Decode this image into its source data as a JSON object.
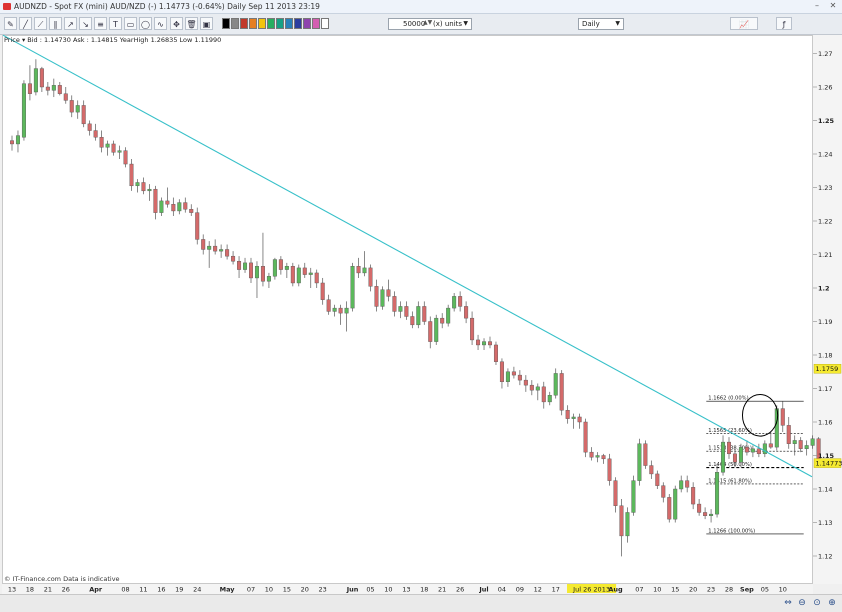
{
  "window": {
    "title": "AUDNZD - Spot FX (mini) AUD/NZD (-)   1.14773 (-0.64%)   Daily  Sep 11 2013 23:19",
    "units_value": "50000",
    "units_label": "(x) units",
    "period": "Daily"
  },
  "chart_header": {
    "price_label": "Price",
    "quote_info": "Bid : 1.14730 Ask : 1.14815 YearHigh 1.26835 Low 1.11990"
  },
  "footer": {
    "credit": "© IT-Finance.com  Data is indicative"
  },
  "icons": {
    "title": "app-icon",
    "minimize": "minimize-icon",
    "close": "close-icon",
    "toolbar": [
      "pencil-icon",
      "line-icon",
      "ray-icon",
      "channel-icon",
      "arrow-icon",
      "fibonacci-icon",
      "text-icon",
      "rectangle-icon",
      "ellipse-icon",
      "trash-icon"
    ],
    "bottom": [
      "zoom-in-icon",
      "zoom-out-icon",
      "fit-icon",
      "search-icon"
    ]
  },
  "colors": {
    "up_candle": "#5cb85c",
    "down_candle": "#d46a6a",
    "trendline": "#37c0c9",
    "price_label_current": "#f5ea30",
    "price_label_alt": "#f5ea30",
    "axis_highlight": "#f5ea30"
  },
  "chart_data": {
    "type": "candlestick",
    "instrument": "AUDNZD",
    "ylim": [
      1.114,
      1.275
    ],
    "y_ticks": [
      "1.27",
      "1.26",
      "1.25",
      "1.24",
      "1.23",
      "1.22",
      "1.21",
      "1.2",
      "1.19",
      "1.18",
      "1.17",
      "1.16",
      "1.15",
      "1.14",
      "1.13",
      "1.12"
    ],
    "y_ticks_bold": [
      "1.25",
      "1.2",
      "1.15"
    ],
    "current_price": {
      "label": "1.14773",
      "value": 1.14773
    },
    "marker_price": {
      "label": "1.1759",
      "value": 1.1759
    },
    "x_ticks": [
      {
        "label": "13",
        "i": 0
      },
      {
        "label": "18",
        "i": 3
      },
      {
        "label": "21",
        "i": 6
      },
      {
        "label": "26",
        "i": 9
      },
      {
        "label": "Apr",
        "i": 14,
        "bold": true
      },
      {
        "label": "08",
        "i": 19
      },
      {
        "label": "11",
        "i": 22
      },
      {
        "label": "16",
        "i": 25
      },
      {
        "label": "19",
        "i": 28
      },
      {
        "label": "24",
        "i": 31
      },
      {
        "label": "May",
        "i": 36,
        "bold": true
      },
      {
        "label": "07",
        "i": 40
      },
      {
        "label": "10",
        "i": 43
      },
      {
        "label": "15",
        "i": 46
      },
      {
        "label": "20",
        "i": 49
      },
      {
        "label": "23",
        "i": 52
      },
      {
        "label": "Jun",
        "i": 57,
        "bold": true
      },
      {
        "label": "05",
        "i": 60
      },
      {
        "label": "10",
        "i": 63
      },
      {
        "label": "13",
        "i": 66
      },
      {
        "label": "18",
        "i": 69
      },
      {
        "label": "21",
        "i": 72
      },
      {
        "label": "26",
        "i": 75
      },
      {
        "label": "Jul",
        "i": 79,
        "bold": true
      },
      {
        "label": "04",
        "i": 82
      },
      {
        "label": "09",
        "i": 85
      },
      {
        "label": "12",
        "i": 88
      },
      {
        "label": "17",
        "i": 91
      },
      {
        "label": "22",
        "i": 94
      },
      {
        "label": "Jul 26 2013",
        "i": 97,
        "highlight": true
      },
      {
        "label": "Aug",
        "i": 101,
        "bold": true
      },
      {
        "label": "07",
        "i": 105
      },
      {
        "label": "10",
        "i": 108
      },
      {
        "label": "15",
        "i": 111
      },
      {
        "label": "20",
        "i": 114
      },
      {
        "label": "23",
        "i": 117
      },
      {
        "label": "28",
        "i": 120
      },
      {
        "label": "Sep",
        "i": 123,
        "bold": true
      },
      {
        "label": "05",
        "i": 126
      },
      {
        "label": "10",
        "i": 129
      }
    ],
    "candles": [
      [
        1.244,
        1.2455,
        1.241,
        1.243
      ],
      [
        1.243,
        1.247,
        1.2405,
        1.2455
      ],
      [
        1.245,
        1.262,
        1.244,
        1.261
      ],
      [
        1.261,
        1.2665,
        1.256,
        1.258
      ],
      [
        1.2585,
        1.2683,
        1.2575,
        1.2655
      ],
      [
        1.2655,
        1.266,
        1.2585,
        1.26
      ],
      [
        1.26,
        1.2615,
        1.2575,
        1.259
      ],
      [
        1.259,
        1.2625,
        1.257,
        1.2605
      ],
      [
        1.2605,
        1.2615,
        1.2575,
        1.258
      ],
      [
        1.258,
        1.26,
        1.255,
        1.256
      ],
      [
        1.256,
        1.2575,
        1.251,
        1.2525
      ],
      [
        1.2525,
        1.256,
        1.2505,
        1.2545
      ],
      [
        1.2545,
        1.256,
        1.248,
        1.249
      ],
      [
        1.249,
        1.25,
        1.2455,
        1.247
      ],
      [
        1.247,
        1.249,
        1.244,
        1.245
      ],
      [
        1.245,
        1.247,
        1.2405,
        1.242
      ],
      [
        1.242,
        1.244,
        1.2395,
        1.243
      ],
      [
        1.243,
        1.244,
        1.2395,
        1.2405
      ],
      [
        1.2405,
        1.2425,
        1.2385,
        1.241
      ],
      [
        1.241,
        1.242,
        1.236,
        1.237
      ],
      [
        1.237,
        1.2385,
        1.229,
        1.2305
      ],
      [
        1.2305,
        1.2325,
        1.2285,
        1.2315
      ],
      [
        1.2315,
        1.233,
        1.228,
        1.229
      ],
      [
        1.229,
        1.231,
        1.226,
        1.2295
      ],
      [
        1.2295,
        1.2305,
        1.2205,
        1.2225
      ],
      [
        1.2225,
        1.227,
        1.2215,
        1.226
      ],
      [
        1.226,
        1.23,
        1.224,
        1.225
      ],
      [
        1.225,
        1.227,
        1.2215,
        1.223
      ],
      [
        1.223,
        1.2265,
        1.222,
        1.2255
      ],
      [
        1.2255,
        1.227,
        1.2225,
        1.2235
      ],
      [
        1.2235,
        1.225,
        1.2215,
        1.2225
      ],
      [
        1.2225,
        1.224,
        1.213,
        1.2145
      ],
      [
        1.2145,
        1.216,
        1.21,
        1.2115
      ],
      [
        1.2115,
        1.214,
        1.206,
        1.2125
      ],
      [
        1.2125,
        1.2145,
        1.21,
        1.211
      ],
      [
        1.211,
        1.213,
        1.209,
        1.2115
      ],
      [
        1.2115,
        1.213,
        1.2085,
        1.2095
      ],
      [
        1.2095,
        1.211,
        1.207,
        1.208
      ],
      [
        1.208,
        1.2095,
        1.203,
        1.2055
      ],
      [
        1.2055,
        1.209,
        1.2045,
        1.2075
      ],
      [
        1.2075,
        1.209,
        1.2015,
        1.203
      ],
      [
        1.203,
        1.208,
        1.197,
        1.2065
      ],
      [
        1.2065,
        1.2165,
        1.2005,
        1.202
      ],
      [
        1.202,
        1.2045,
        1.2,
        1.2035
      ],
      [
        1.2035,
        1.209,
        1.2025,
        1.2085
      ],
      [
        1.2085,
        1.2095,
        1.204,
        1.2055
      ],
      [
        1.2055,
        1.2075,
        1.203,
        1.2065
      ],
      [
        1.2065,
        1.2075,
        1.2005,
        1.2015
      ],
      [
        1.2015,
        1.207,
        1.2005,
        1.206
      ],
      [
        1.206,
        1.2075,
        1.203,
        1.204
      ],
      [
        1.204,
        1.206,
        1.2,
        1.2045
      ],
      [
        1.2045,
        1.2055,
        1.2,
        1.2015
      ],
      [
        1.2015,
        1.203,
        1.195,
        1.1965
      ],
      [
        1.1965,
        1.198,
        1.192,
        1.193
      ],
      [
        1.193,
        1.195,
        1.1915,
        1.194
      ],
      [
        1.194,
        1.195,
        1.189,
        1.1925
      ],
      [
        1.1925,
        1.196,
        1.187,
        1.194
      ],
      [
        1.194,
        1.2075,
        1.193,
        1.2065
      ],
      [
        1.2065,
        1.209,
        1.203,
        1.2045
      ],
      [
        1.2045,
        1.211,
        1.2035,
        1.206
      ],
      [
        1.206,
        1.207,
        1.199,
        1.2005
      ],
      [
        1.2005,
        1.2025,
        1.193,
        1.1945
      ],
      [
        1.1945,
        1.2005,
        1.1935,
        1.1995
      ],
      [
        1.1995,
        1.2025,
        1.196,
        1.1975
      ],
      [
        1.1975,
        1.199,
        1.1915,
        1.193
      ],
      [
        1.193,
        1.196,
        1.191,
        1.1945
      ],
      [
        1.1945,
        1.196,
        1.1905,
        1.1915
      ],
      [
        1.1915,
        1.193,
        1.188,
        1.189
      ],
      [
        1.189,
        1.196,
        1.188,
        1.1945
      ],
      [
        1.1945,
        1.196,
        1.189,
        1.19
      ],
      [
        1.19,
        1.1915,
        1.182,
        1.184
      ],
      [
        1.184,
        1.192,
        1.183,
        1.191
      ],
      [
        1.191,
        1.1925,
        1.188,
        1.1895
      ],
      [
        1.1895,
        1.195,
        1.1885,
        1.194
      ],
      [
        1.194,
        1.1985,
        1.193,
        1.1975
      ],
      [
        1.1975,
        1.199,
        1.193,
        1.1945
      ],
      [
        1.1945,
        1.196,
        1.1895,
        1.191
      ],
      [
        1.191,
        1.193,
        1.183,
        1.1845
      ],
      [
        1.1845,
        1.186,
        1.1815,
        1.183
      ],
      [
        1.183,
        1.185,
        1.1815,
        1.184
      ],
      [
        1.184,
        1.1855,
        1.182,
        1.183
      ],
      [
        1.183,
        1.184,
        1.177,
        1.178
      ],
      [
        1.178,
        1.179,
        1.17,
        1.172
      ],
      [
        1.172,
        1.176,
        1.1705,
        1.175
      ],
      [
        1.175,
        1.1765,
        1.173,
        1.174
      ],
      [
        1.174,
        1.1755,
        1.171,
        1.1725
      ],
      [
        1.1725,
        1.174,
        1.169,
        1.171
      ],
      [
        1.171,
        1.1725,
        1.168,
        1.1695
      ],
      [
        1.1695,
        1.1715,
        1.1665,
        1.1705
      ],
      [
        1.1705,
        1.172,
        1.164,
        1.166
      ],
      [
        1.166,
        1.169,
        1.165,
        1.168
      ],
      [
        1.168,
        1.176,
        1.167,
        1.1745
      ],
      [
        1.1745,
        1.1755,
        1.162,
        1.1635
      ],
      [
        1.1635,
        1.165,
        1.1595,
        1.161
      ],
      [
        1.161,
        1.1625,
        1.158,
        1.1615
      ],
      [
        1.1615,
        1.1625,
        1.158,
        1.16
      ],
      [
        1.16,
        1.161,
        1.1495,
        1.151
      ],
      [
        1.151,
        1.1525,
        1.1485,
        1.1495
      ],
      [
        1.1495,
        1.151,
        1.148,
        1.15
      ],
      [
        1.15,
        1.1505,
        1.1475,
        1.149
      ],
      [
        1.149,
        1.1505,
        1.141,
        1.1425
      ],
      [
        1.1425,
        1.1435,
        1.133,
        1.135
      ],
      [
        1.135,
        1.137,
        1.1199,
        1.126
      ],
      [
        1.126,
        1.1345,
        1.124,
        1.133
      ],
      [
        1.133,
        1.144,
        1.132,
        1.1425
      ],
      [
        1.1425,
        1.155,
        1.141,
        1.1535
      ],
      [
        1.1535,
        1.1545,
        1.146,
        1.147
      ],
      [
        1.147,
        1.1485,
        1.143,
        1.1445
      ],
      [
        1.1445,
        1.1455,
        1.14,
        1.141
      ],
      [
        1.141,
        1.142,
        1.136,
        1.1375
      ],
      [
        1.1375,
        1.1385,
        1.13,
        1.131
      ],
      [
        1.131,
        1.141,
        1.13,
        1.14
      ],
      [
        1.14,
        1.144,
        1.139,
        1.1425
      ],
      [
        1.1425,
        1.144,
        1.139,
        1.1405
      ],
      [
        1.1405,
        1.142,
        1.134,
        1.1355
      ],
      [
        1.1355,
        1.137,
        1.132,
        1.133
      ],
      [
        1.133,
        1.1345,
        1.131,
        1.132
      ],
      [
        1.132,
        1.134,
        1.13,
        1.1325
      ],
      [
        1.1325,
        1.1475,
        1.1315,
        1.145
      ],
      [
        1.145,
        1.156,
        1.144,
        1.154
      ],
      [
        1.154,
        1.1555,
        1.149,
        1.1505
      ],
      [
        1.1505,
        1.152,
        1.1465,
        1.148
      ],
      [
        1.148,
        1.1535,
        1.1465,
        1.1525
      ],
      [
        1.1525,
        1.1545,
        1.15,
        1.151
      ],
      [
        1.151,
        1.153,
        1.1495,
        1.152
      ],
      [
        1.152,
        1.1535,
        1.1495,
        1.1505
      ],
      [
        1.1505,
        1.1545,
        1.1495,
        1.1535
      ],
      [
        1.1535,
        1.157,
        1.152,
        1.1525
      ],
      [
        1.1525,
        1.165,
        1.1515,
        1.164
      ],
      [
        1.164,
        1.1662,
        1.157,
        1.159
      ],
      [
        1.159,
        1.1615,
        1.152,
        1.1535
      ],
      [
        1.1535,
        1.156,
        1.15,
        1.1545
      ],
      [
        1.1545,
        1.1555,
        1.151,
        1.152
      ],
      [
        1.152,
        1.1545,
        1.15,
        1.153
      ],
      [
        1.153,
        1.156,
        1.152,
        1.155
      ],
      [
        1.155,
        1.1555,
        1.147,
        1.148
      ]
    ],
    "trendline": {
      "from": [
        0,
        1.274
      ],
      "to": [
        132,
        1.1455
      ]
    },
    "fibonacci": {
      "levels": [
        {
          "label": "1.1662 (0.00%)",
          "value": 1.1662
        },
        {
          "label": "1.1565 (23.60%)",
          "value": 1.1565
        },
        {
          "label": "1.1513 (38.20%)",
          "value": 1.1513
        },
        {
          "label": "1.1464 (50.00%)",
          "value": 1.1464
        },
        {
          "label": "1.1415 (61.80%)",
          "value": 1.1415
        },
        {
          "label": "1.1266 (100.00%)",
          "value": 1.1266
        }
      ]
    },
    "ellipse_highlight": {
      "center_index": 125.2,
      "center_value": 1.162,
      "half_width_bars": 1.9,
      "half_height_value": 0.0062
    }
  }
}
